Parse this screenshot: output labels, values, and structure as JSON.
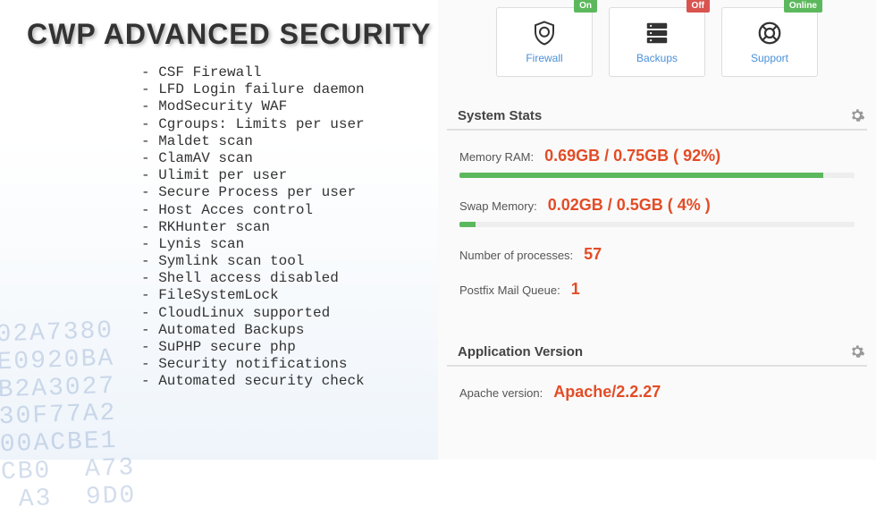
{
  "left": {
    "title": "CWP ADVANCED SECURITY",
    "features": [
      "CSF Firewall",
      "LFD Login failure daemon",
      "ModSecurity WAF",
      "Cgroups: Limits per user",
      "Maldet scan",
      "ClamAV scan",
      "Ulimit per user",
      "Secure Process per user",
      "Host Acces control",
      "RKHunter scan",
      "Lynis scan",
      "Symlink scan tool",
      "Shell access disabled",
      "FileSystemLock",
      "CloudLinux supported",
      "Automated Backups",
      "SuPHP secure php",
      "Security notifications",
      "Automated security check"
    ]
  },
  "tiles": {
    "firewall": {
      "label": "Firewall",
      "badge": "On"
    },
    "backups": {
      "label": "Backups",
      "badge": "Off"
    },
    "support": {
      "label": "Support",
      "badge": "Online"
    }
  },
  "system_stats": {
    "title": "System Stats",
    "ram": {
      "label": "Memory RAM:",
      "value": "0.69GB / 0.75GB ( 92%)",
      "pct": 92
    },
    "swap": {
      "label": "Swap Memory:",
      "value": "0.02GB / 0.5GB ( 4% )",
      "pct": 4
    },
    "processes": {
      "label": "Number of processes:",
      "value": "57"
    },
    "mailq": {
      "label": "Postfix Mail Queue:",
      "value": "1"
    }
  },
  "app_version": {
    "title": "Application Version",
    "apache": {
      "label": "Apache version:",
      "value": "Apache/2.2.27"
    }
  }
}
